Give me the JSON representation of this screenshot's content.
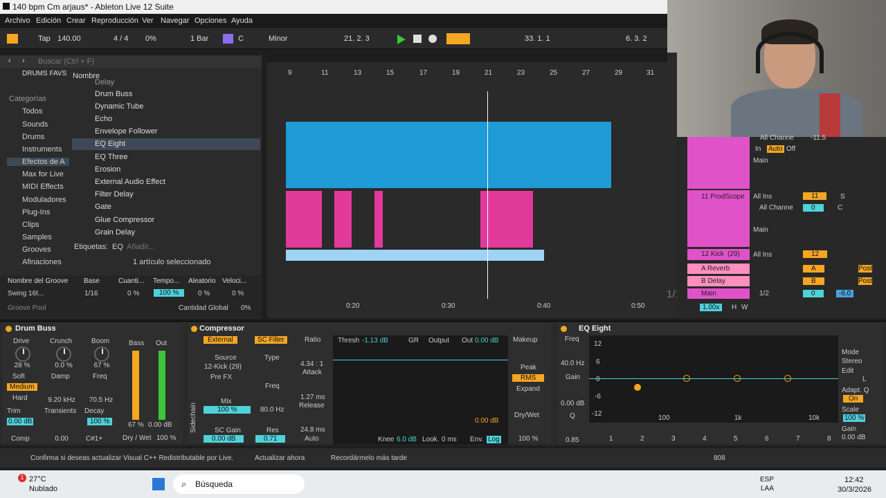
{
  "window": {
    "title": "140 bpm Cm arjaus* - Ableton Live 12 Suite"
  },
  "menu": [
    "Archivo",
    "Edición",
    "Crear",
    "Reproducción",
    "Ver",
    "Navegar",
    "Opciones",
    "Ayuda"
  ],
  "transport": {
    "tap": "Tap",
    "bpm": "140.00",
    "meter": "4 / 4",
    "swing": "0%",
    "quantize": "1 Bar",
    "key": "C",
    "scale": "Minor",
    "position": "21.   2.   3",
    "loop_start": "33.   1.   1",
    "loop_len": "6.   3.   2"
  },
  "browser": {
    "search_placeholder": "Buscar (Ctrl + F)",
    "collection": "DRUMS FAVS",
    "col_name": "Nombre",
    "categories_title": "Categorías",
    "categories": [
      "Todos",
      "Sounds",
      "Drums",
      "Instruments",
      "Efectos de A",
      "Max for Live",
      "MIDI Effects",
      "Moduladores",
      "Plug-Ins",
      "Clips",
      "Samples",
      "Grooves",
      "Afinaciones"
    ],
    "items": [
      "Delay",
      "Drum Buss",
      "Dynamic Tube",
      "Echo",
      "Envelope Follower",
      "EQ Eight",
      "EQ Three",
      "Erosion",
      "External Audio Effect",
      "Filter Delay",
      "Gate",
      "Glue Compressor",
      "Grain Delay"
    ],
    "tags_label": "Etiquetas:",
    "tag": "EQ",
    "add_tag": "Añadir...",
    "selection_status": "1 artículo seleccionado"
  },
  "groove": {
    "headers": [
      "Nombre del Groove",
      "Base",
      "Cuanti...",
      "Tempo...",
      "Aleatorio",
      "Veloci..."
    ],
    "row": [
      "Swing 16t...",
      "1/16",
      "0 %",
      "100 %",
      "0 %",
      "0 %"
    ],
    "pool": "Groove Pool",
    "global_label": "Cantidad Global",
    "global_value": "0%"
  },
  "arrangement": {
    "bar_numbers": [
      "9",
      "11",
      "13",
      "15",
      "17",
      "19",
      "21",
      "23",
      "25",
      "27",
      "29",
      "31"
    ],
    "time_labels": [
      "0:20",
      "0:30",
      "0:40",
      "0:50"
    ],
    "zoom": "1/1"
  },
  "mixer": {
    "channel_top": "All Channe",
    "in": "In",
    "auto": "Auto",
    "off": "Off",
    "inf": "-∞",
    "main": "Main",
    "track11": "11 ProdScope",
    "track11_num": "11",
    "all_ins": "All Ins",
    "track12": "12 Kick",
    "track12_count": "(29)",
    "track12_num": "12",
    "return_a": "A Reverb",
    "return_b": "B Delay",
    "master": "Main",
    "letter_a": "A",
    "letter_b": "B",
    "post": "Post",
    "s": "S",
    "c": "C",
    "cue": "1/2",
    "master_vol": "-6.0",
    "zero": "0",
    "zoom_val": "1.00x",
    "h": "H",
    "w": "W",
    "vol_top": "-11.5"
  },
  "drum_buss": {
    "title": "Drum Buss",
    "drive": "Drive",
    "drive_v": "28 %",
    "crunch": "Crunch",
    "crunch_v": "0.0 %",
    "boom": "Boom",
    "boom_v": "67 %",
    "soft": "Soft",
    "medium": "Medium",
    "hard": "Hard",
    "damp": "Damp",
    "damp_v": "9.20 kHz",
    "freq": "Freq",
    "freq_v": "70.5 Hz",
    "trim": "Trim",
    "trim_v": "0.00 dB",
    "transients": "Transients",
    "transients_v": "0.00",
    "decay": "Decay",
    "decay_v": "100 %",
    "comp": "Comp",
    "c1": "C#1+",
    "bass": "Bass",
    "out": "Out",
    "bass_v": "67 %",
    "out_v": "0.00 dB",
    "drywet": "Dry / Wet",
    "drywet_v": "100 %"
  },
  "compressor": {
    "title": "Compressor",
    "external": "External",
    "sc_filter": "SC Filter",
    "source": "Source",
    "source_v": "12-Kick (29)",
    "prefx": "Pre FX",
    "type": "Type",
    "freq": "Freq",
    "freq_v": "80.0 Hz",
    "mix": "Mix",
    "mix_v": "100 %",
    "scgain": "SC Gain",
    "scgain_v": "0.00 dB",
    "res": "Res",
    "res_v": "0.71",
    "sidechain": "Sidechain",
    "ratio": "Ratio",
    "ratio_v": "4.34 : 1",
    "attack": "Attack",
    "attack_v": "1.27 ms",
    "release": "Release",
    "release_v": "24.8 ms",
    "auto": "Auto",
    "thresh": "Thresh",
    "thresh_v": "-1.13 dB",
    "gr": "GR",
    "output": "Output",
    "out": "Out",
    "out_v": "0.00 dB",
    "makeup": "Makeup",
    "peak": "Peak",
    "rms": "RMS",
    "expand": "Expand",
    "drywet": "Dry/Wet",
    "drywet_v": "100 %",
    "knee": "Knee",
    "knee_v": "6.0 dB",
    "look": "Look.",
    "look_v": "0 ms",
    "env": "Env.",
    "log": "Log",
    "meter_val": "0.00 dB"
  },
  "eq": {
    "title": "EQ Eight",
    "freq": "Freq",
    "freq_v": "40.0 Hz",
    "gain": "Gain",
    "gain_v": "0.00 dB",
    "q": "Q",
    "q_v": "0.85",
    "db_labels": [
      "12",
      "6",
      "0",
      "-6",
      "-12"
    ],
    "hz_labels": [
      "100",
      "1k",
      "10k"
    ],
    "bands": [
      "1",
      "2",
      "3",
      "4",
      "5",
      "6",
      "7",
      "8"
    ],
    "mode": "Mode",
    "mode_v": "Stereo",
    "edit": "Edit",
    "edit_v": "L",
    "adapt": "Adapt. Q",
    "adapt_v": "On",
    "scale": "Scale",
    "scale_v": "100 %",
    "gain2": "Gain",
    "gain2_v": "0.00 dB"
  },
  "status": {
    "message": "Confirma si deseas actualizar Visual C++ Redistributable por Live.",
    "update_now": "Actualizar ahora",
    "remind_later": "Recordármelo más tarde",
    "cpu": "808"
  },
  "taskbar": {
    "temp": "27°C",
    "weather": "Nublado",
    "badge": "1",
    "search": "Búsqueda",
    "lang1": "ESP",
    "lang2": "LAA",
    "time": "12:42",
    "date": "30/3/2026"
  },
  "colors": {
    "accent": "#f5a623",
    "blue_clip": "#1e9ad6",
    "pink_clip": "#e23a9b",
    "track_pink": "#e052c8",
    "cyan": "#4fd1d9"
  }
}
